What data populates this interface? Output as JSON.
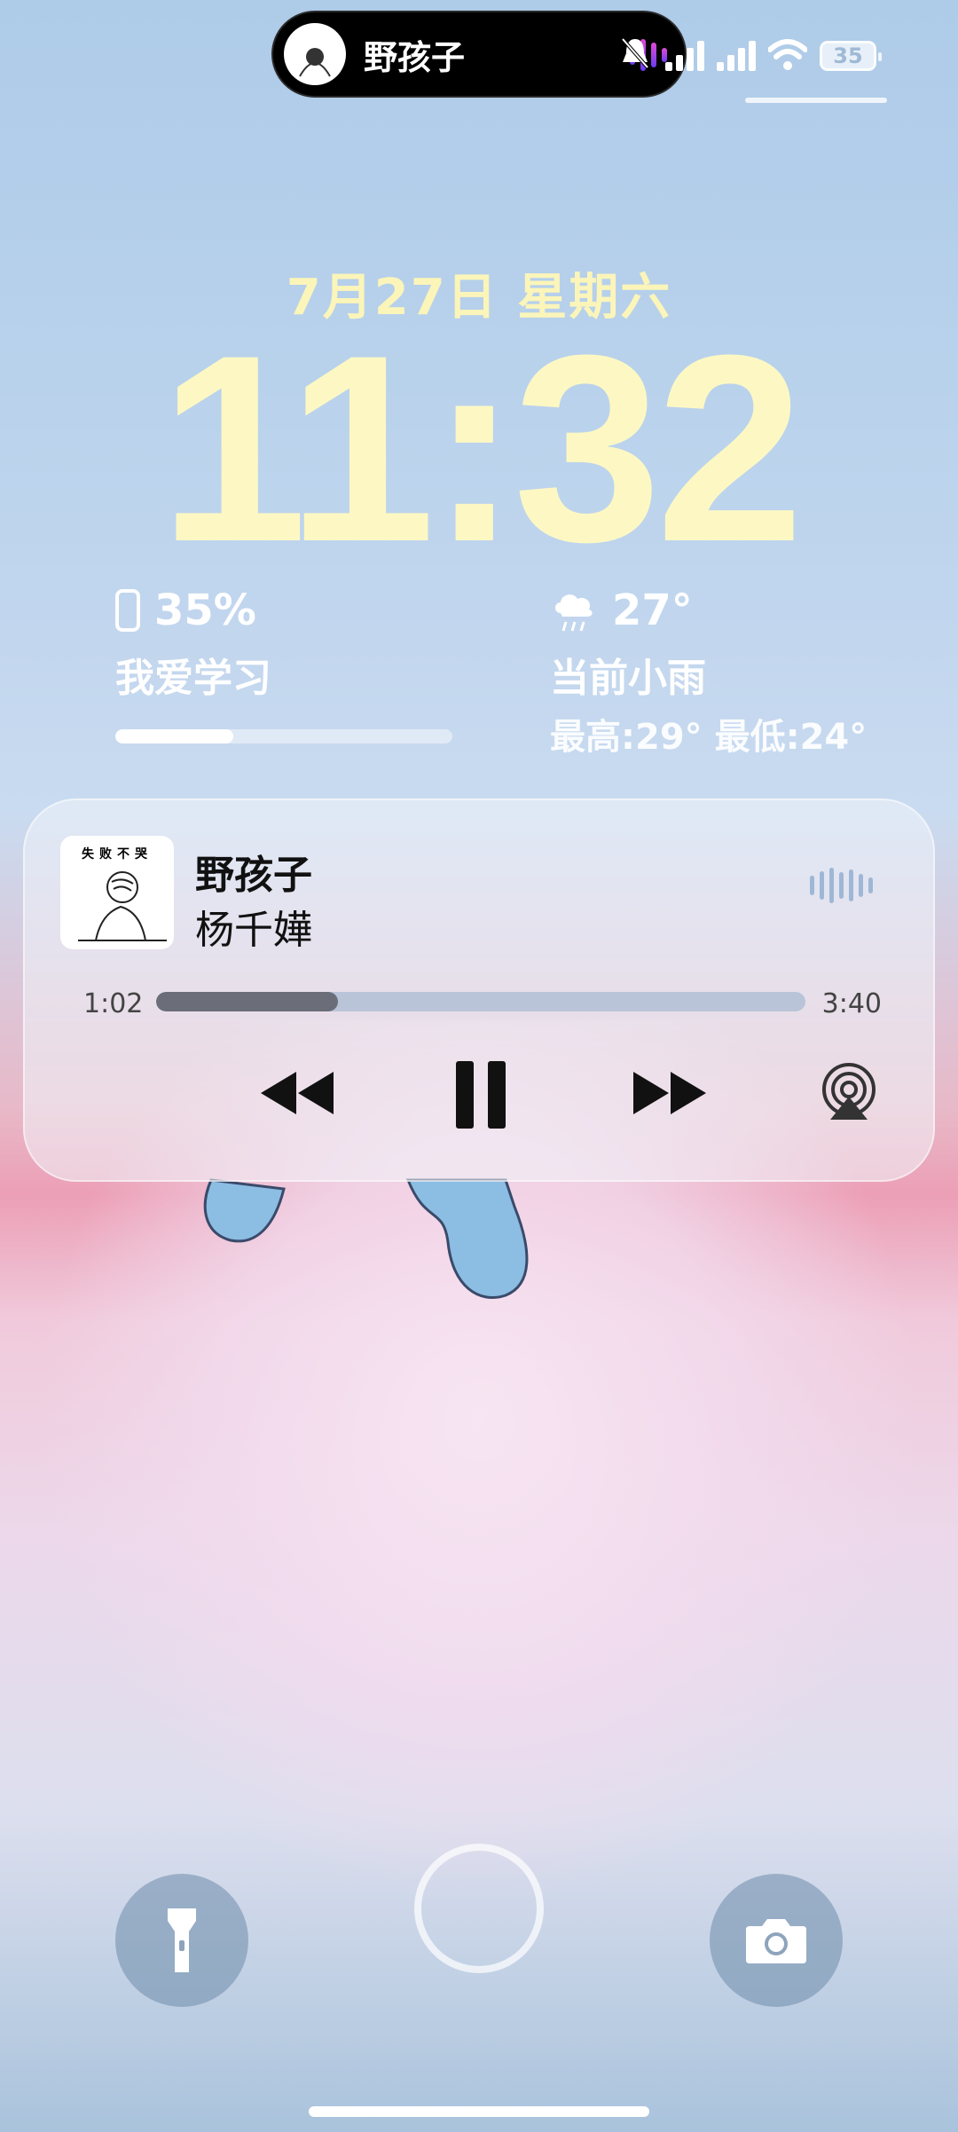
{
  "island": {
    "now_playing_title": "野孩子"
  },
  "status": {
    "battery_text": "35"
  },
  "lockscreen": {
    "date": "7月27日 星期六",
    "time": "11:32"
  },
  "widgets": {
    "battery": {
      "percent": "35%",
      "label": "我爱学习",
      "fill": 0.35
    },
    "weather": {
      "temp": "27°",
      "condition": "当前小雨",
      "range": "最高:29° 最低:24°"
    }
  },
  "player": {
    "album_text": "失败不哭",
    "title": "野孩子",
    "artist": "杨千嬅",
    "elapsed": "1:02",
    "total": "3:40",
    "progress": 0.28
  },
  "colors": {
    "clock": "#fdf8c3",
    "accent_wave": "#e04bd6"
  },
  "icons": [
    "flashlight-icon",
    "camera-icon",
    "rewind-icon",
    "pause-icon",
    "forward-icon",
    "airplay-icon",
    "rain-cloud-icon",
    "phone-icon"
  ]
}
